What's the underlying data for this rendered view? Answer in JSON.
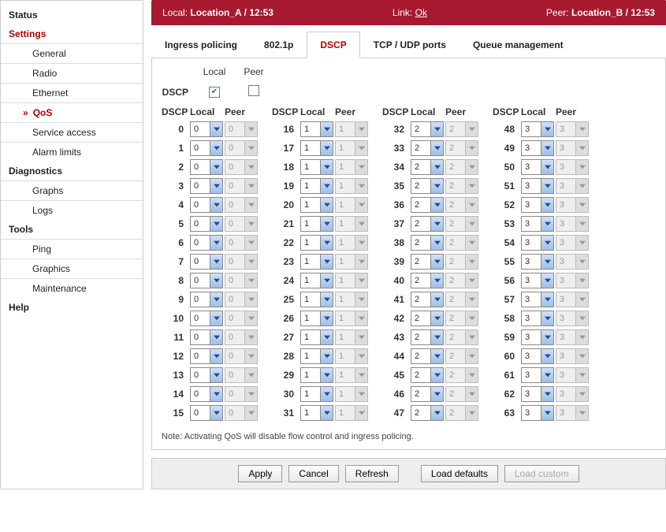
{
  "sidebar": {
    "items": [
      "Status",
      "Settings",
      "Diagnostics",
      "Tools",
      "Help"
    ],
    "settings_subs": [
      "General",
      "Radio",
      "Ethernet",
      "QoS",
      "Service access",
      "Alarm limits"
    ],
    "diag_subs": [
      "Graphs",
      "Logs"
    ],
    "tools_subs": [
      "Ping",
      "Graphics",
      "Maintenance"
    ]
  },
  "banner": {
    "local_label": "Local:",
    "local_value": "Location_A / 12:53",
    "link_label": "Link:",
    "link_value": "Ok",
    "peer_label": "Peer:",
    "peer_value": "Location_B / 12:53"
  },
  "tabs": [
    "Ingress policing",
    "802.1p",
    "DSCP",
    "TCP / UDP ports",
    "Queue management"
  ],
  "dscp_panel": {
    "row_label": "DSCP",
    "local_label": "Local",
    "peer_label": "Peer",
    "local_checked": true,
    "peer_checked": false,
    "headers": [
      "DSCP",
      "Local",
      "Peer"
    ],
    "columns": [
      {
        "start": 0,
        "local": "0",
        "peer": "0"
      },
      {
        "start": 16,
        "local": "1",
        "peer": "1"
      },
      {
        "start": 32,
        "local": "2",
        "peer": "2"
      },
      {
        "start": 48,
        "local": "3",
        "peer": "3"
      }
    ],
    "rows_per_col": 16,
    "note": "Note: Activating QoS will disable flow control and ingress policing."
  },
  "footer": {
    "apply": "Apply",
    "cancel": "Cancel",
    "refresh": "Refresh",
    "load_defaults": "Load defaults",
    "load_custom": "Load custom"
  }
}
